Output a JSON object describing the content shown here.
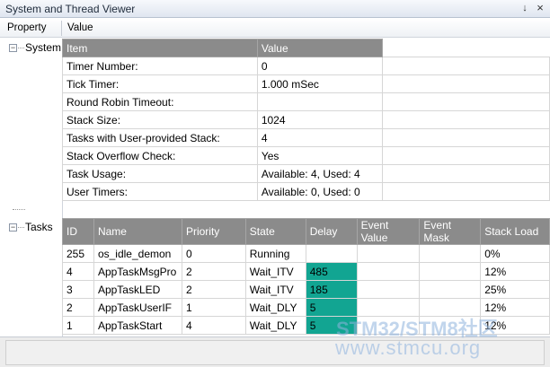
{
  "window": {
    "title": "System and Thread Viewer",
    "pin_glyph": "↓",
    "close_glyph": "×"
  },
  "columns": {
    "property": "Property",
    "value": "Value"
  },
  "tree": {
    "system": {
      "label": "System",
      "expander": "−"
    },
    "tasks": {
      "label": "Tasks",
      "expander": "−"
    }
  },
  "system_table": {
    "headers": [
      "Item",
      "Value"
    ],
    "rows": [
      [
        "Timer Number:",
        "0"
      ],
      [
        "Tick Timer:",
        "1.000 mSec"
      ],
      [
        "Round Robin Timeout:",
        ""
      ],
      [
        "Stack Size:",
        "1024"
      ],
      [
        "Tasks with User-provided Stack:",
        "4"
      ],
      [
        "Stack Overflow Check:",
        "Yes"
      ],
      [
        "Task Usage:",
        "Available: 4, Used: 4"
      ],
      [
        "User Timers:",
        "Available: 0, Used: 0"
      ]
    ]
  },
  "tasks_table": {
    "headers": [
      "ID",
      "Name",
      "Priority",
      "State",
      "Delay",
      "Event Value",
      "Event Mask",
      "Stack Load"
    ],
    "rows": [
      [
        "255",
        "os_idle_demon",
        "0",
        "Running",
        "",
        "",
        "",
        "0%"
      ],
      [
        "4",
        "AppTaskMsgPro",
        "2",
        "Wait_ITV",
        "485",
        "",
        "",
        "12%"
      ],
      [
        "3",
        "AppTaskLED",
        "2",
        "Wait_ITV",
        "185",
        "",
        "",
        "25%"
      ],
      [
        "2",
        "AppTaskUserIF",
        "1",
        "Wait_DLY",
        "5",
        "",
        "",
        "12%"
      ],
      [
        "1",
        "AppTaskStart",
        "4",
        "Wait_DLY",
        "5",
        "",
        "",
        "12%"
      ]
    ],
    "highlight_color": "#12a592"
  },
  "watermark": {
    "line1": "STM32/STM8社区",
    "line2": "www.stmcu.org"
  }
}
